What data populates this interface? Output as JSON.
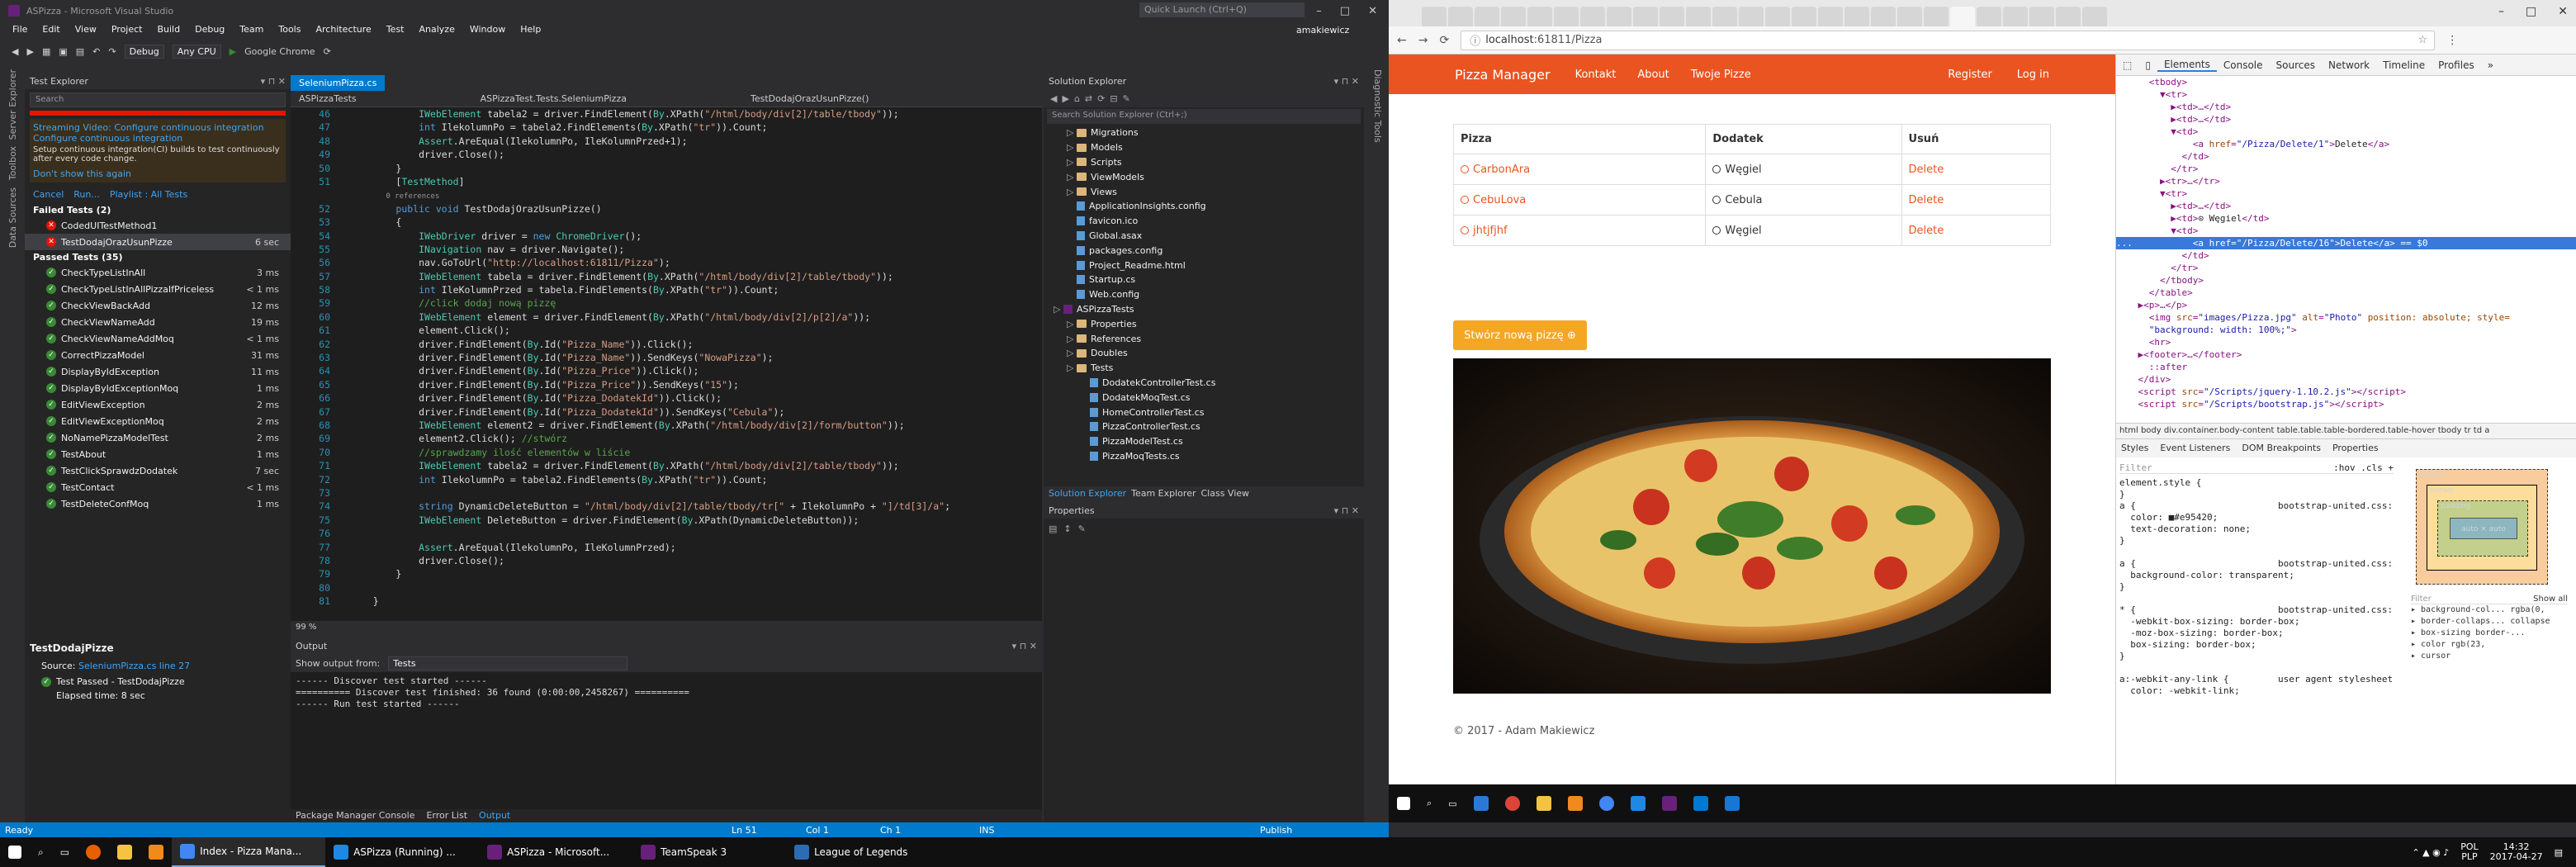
{
  "vs": {
    "title": "ASPizza - Microsoft Visual Studio",
    "quick_launch": "Quick Launch (Ctrl+Q)",
    "user": "amakiewicz",
    "menu": [
      "File",
      "Edit",
      "View",
      "Project",
      "Build",
      "Debug",
      "Team",
      "Tools",
      "Architecture",
      "Test",
      "Analyze",
      "Window",
      "Help"
    ],
    "toolbar": {
      "config": "Debug",
      "platform": "Any CPU",
      "run_target": "Google Chrome"
    },
    "left_sidebar": [
      "Server Explorer",
      "Toolbox",
      "Data Sources"
    ],
    "right_sidebar": [
      "Diagnostic Tools"
    ],
    "test_explorer": {
      "title": "Test Explorer",
      "search_placeholder": "Search",
      "banner_title": "Streaming Video: Configure continuous integration",
      "banner_link": "Configure continuous integration",
      "banner_text": "Setup continuous integration(CI) builds to test continuously after every code change.",
      "dont_show": "Don't show this again",
      "actions": [
        "Cancel",
        "Run...",
        "Playlist : All Tests"
      ],
      "failed_header": "Failed Tests (2)",
      "failed": [
        {
          "name": "CodedUITestMethod1",
          "time": ""
        },
        {
          "name": "TestDodajOrazUsunPizze",
          "time": "6 sec"
        }
      ],
      "passed_header": "Passed Tests (35)",
      "passed": [
        {
          "name": "CheckTypeListInAll",
          "time": "3 ms"
        },
        {
          "name": "CheckTypeListInAllPizzaIfPriceless",
          "time": "< 1 ms"
        },
        {
          "name": "CheckViewBackAdd",
          "time": "12 ms"
        },
        {
          "name": "CheckViewNameAdd",
          "time": "19 ms"
        },
        {
          "name": "CheckViewNameAddMoq",
          "time": "< 1 ms"
        },
        {
          "name": "CorrectPizzaModel",
          "time": "31 ms"
        },
        {
          "name": "DisplayByIdException",
          "time": "11 ms"
        },
        {
          "name": "DisplayByIdExceptionMoq",
          "time": "1 ms"
        },
        {
          "name": "EditViewException",
          "time": "2 ms"
        },
        {
          "name": "EditViewExceptionMoq",
          "time": "2 ms"
        },
        {
          "name": "NoNamePizzaModelTest",
          "time": "2 ms"
        },
        {
          "name": "TestAbout",
          "time": "1 ms"
        },
        {
          "name": "TestClickSprawdzDodatek",
          "time": "7 sec"
        },
        {
          "name": "TestContact",
          "time": "< 1 ms"
        },
        {
          "name": "TestDeleteConfMoq",
          "time": "1 ms"
        }
      ],
      "detail_title": "TestDodajPizze",
      "detail_source_label": "Source:",
      "detail_source": "SeleniumPizza.cs line 27",
      "detail_result": "Test Passed - TestDodajPizze",
      "detail_elapsed": "Elapsed time: 8 sec"
    },
    "editor": {
      "tab": "SeleniumPizza.cs",
      "nav_left": "ASPizzaTests",
      "nav_mid": "ASPizzaTest.Tests.SeleniumPizza",
      "nav_right": "TestDodajOrazUsunPizze()",
      "zoom": "99 %",
      "lines": [
        {
          "n": "46",
          "t": "            IWebElement tabela2 = driver.FindElement(By.XPath(\"/html/body/div[2]/table/tbody\"));"
        },
        {
          "n": "47",
          "t": "            int IlekolumnPo = tabela2.FindElements(By.XPath(\"tr\")).Count;"
        },
        {
          "n": "48",
          "t": "            Assert.AreEqual(IlekolumnPo, IleKolumnPrzed+1);"
        },
        {
          "n": "49",
          "t": "            driver.Close();"
        },
        {
          "n": "50",
          "t": "        }"
        },
        {
          "n": "51",
          "t": "        [TestMethod]"
        },
        {
          "n": "",
          "t": "        0 references"
        },
        {
          "n": "52",
          "t": "        public void TestDodajOrazUsunPizze()"
        },
        {
          "n": "53",
          "t": "        {"
        },
        {
          "n": "54",
          "t": "            IWebDriver driver = new ChromeDriver();"
        },
        {
          "n": "55",
          "t": "            INavigation nav = driver.Navigate();"
        },
        {
          "n": "56",
          "t": "            nav.GoToUrl(\"http://localhost:61811/Pizza\");"
        },
        {
          "n": "57",
          "t": "            IWebElement tabela = driver.FindElement(By.XPath(\"/html/body/div[2]/table/tbody\"));"
        },
        {
          "n": "58",
          "t": "            int IleKolumnPrzed = tabela.FindElements(By.XPath(\"tr\")).Count;"
        },
        {
          "n": "59",
          "t": "            //click dodaj nową pizzę"
        },
        {
          "n": "60",
          "t": "            IWebElement element = driver.FindElement(By.XPath(\"/html/body/div[2]/p[2]/a\"));"
        },
        {
          "n": "61",
          "t": "            element.Click();"
        },
        {
          "n": "62",
          "t": "            driver.FindElement(By.Id(\"Pizza_Name\")).Click();"
        },
        {
          "n": "63",
          "t": "            driver.FindElement(By.Id(\"Pizza_Name\")).SendKeys(\"NowaPizza\");"
        },
        {
          "n": "64",
          "t": "            driver.FindElement(By.Id(\"Pizza_Price\")).Click();"
        },
        {
          "n": "65",
          "t": "            driver.FindElement(By.Id(\"Pizza_Price\")).SendKeys(\"15\");"
        },
        {
          "n": "66",
          "t": "            driver.FindElement(By.Id(\"Pizza_DodatekId\")).Click();"
        },
        {
          "n": "67",
          "t": "            driver.FindElement(By.Id(\"Pizza_DodatekId\")).SendKeys(\"Cebula\");"
        },
        {
          "n": "68",
          "t": "            IWebElement element2 = driver.FindElement(By.XPath(\"/html/body/div[2]/form/button\"));"
        },
        {
          "n": "69",
          "t": "            element2.Click(); //stwórz"
        },
        {
          "n": "70",
          "t": "            //sprawdzamy ilość elementów w liście"
        },
        {
          "n": "71",
          "t": "            IWebElement tabela2 = driver.FindElement(By.XPath(\"/html/body/div[2]/table/tbody\"));"
        },
        {
          "n": "72",
          "t": "            int IlekolumnPo = tabela2.FindElements(By.XPath(\"tr\")).Count;"
        },
        {
          "n": "73",
          "t": ""
        },
        {
          "n": "74",
          "t": "            string DynamicDeleteButton = \"/html/body/div[2]/table/tbody/tr[\" + IlekolumnPo + \"]/td[3]/a\";"
        },
        {
          "n": "75",
          "t": "            IWebElement DeleteButton = driver.FindElement(By.XPath(DynamicDeleteButton));"
        },
        {
          "n": "76",
          "t": ""
        },
        {
          "n": "77",
          "t": "            Assert.AreEqual(IlekolumnPo, IleKolumnPrzed);"
        },
        {
          "n": "78",
          "t": "            driver.Close();"
        },
        {
          "n": "79",
          "t": "        }"
        },
        {
          "n": "80",
          "t": ""
        },
        {
          "n": "81",
          "t": "    }"
        }
      ]
    },
    "output": {
      "title": "Output",
      "show_from_label": "Show output from:",
      "show_from_value": "Tests",
      "lines": [
        "------ Discover test started ------",
        "========== Discover test finished: 36 found (0:00:00,2458267) ==========",
        "------ Run test started ------"
      ],
      "tabs": [
        "Package Manager Console",
        "Error List",
        "Output"
      ]
    },
    "solution_explorer": {
      "title": "Solution Explorer",
      "search_placeholder": "Search Solution Explorer (Ctrl+;)",
      "items": [
        {
          "name": "Migrations",
          "kind": "folder",
          "indent": 1
        },
        {
          "name": "Models",
          "kind": "folder",
          "indent": 1
        },
        {
          "name": "Scripts",
          "kind": "folder",
          "indent": 1
        },
        {
          "name": "ViewModels",
          "kind": "folder",
          "indent": 1
        },
        {
          "name": "Views",
          "kind": "folder",
          "indent": 1
        },
        {
          "name": "ApplicationInsights.config",
          "kind": "file",
          "indent": 1
        },
        {
          "name": "favicon.ico",
          "kind": "file",
          "indent": 1
        },
        {
          "name": "Global.asax",
          "kind": "file",
          "indent": 1
        },
        {
          "name": "packages.config",
          "kind": "file",
          "indent": 1
        },
        {
          "name": "Project_Readme.html",
          "kind": "file",
          "indent": 1
        },
        {
          "name": "Startup.cs",
          "kind": "file",
          "indent": 1
        },
        {
          "name": "Web.config",
          "kind": "file",
          "indent": 1
        },
        {
          "name": "ASPizzaTests",
          "kind": "project",
          "indent": 0
        },
        {
          "name": "Properties",
          "kind": "folder",
          "indent": 1
        },
        {
          "name": "References",
          "kind": "folder",
          "indent": 1
        },
        {
          "name": "Doubles",
          "kind": "folder",
          "indent": 1
        },
        {
          "name": "Tests",
          "kind": "folder",
          "indent": 1
        },
        {
          "name": "DodatekControllerTest.cs",
          "kind": "file",
          "indent": 2
        },
        {
          "name": "DodatekMoqTest.cs",
          "kind": "file",
          "indent": 2
        },
        {
          "name": "HomeControllerTest.cs",
          "kind": "file",
          "indent": 2
        },
        {
          "name": "PizzaControllerTest.cs",
          "kind": "file",
          "indent": 2
        },
        {
          "name": "PizzaModelTest.cs",
          "kind": "file",
          "indent": 2
        },
        {
          "name": "PizzaMoqTests.cs",
          "kind": "file",
          "indent": 2
        }
      ],
      "tabs": [
        "Solution Explorer",
        "Team Explorer",
        "Class View"
      ]
    },
    "properties": {
      "title": "Properties"
    },
    "status": {
      "state": "Ready",
      "ln": "Ln 51",
      "col": "Col 1",
      "ch": "Ch 1",
      "mode": "INS",
      "publish": "Publish"
    }
  },
  "browser": {
    "url_host": "localhost",
    "url_path": ":61811/Pizza",
    "site": {
      "brand": "Pizza Manager",
      "nav": [
        "Kontakt",
        "About",
        "Twoje Pizze"
      ],
      "nav_right": [
        "Register",
        "Log in"
      ],
      "table_headers": [
        "Pizza",
        "Dodatek",
        "Usuń"
      ],
      "rows": [
        {
          "pizza": "CarbonAra",
          "dodatek": "Węgiel",
          "action": "Delete"
        },
        {
          "pizza": "CebuLova",
          "dodatek": "Cebula",
          "action": "Delete"
        },
        {
          "pizza": "jhtjfjhf",
          "dodatek": "Węgiel",
          "action": "Delete"
        }
      ],
      "create_button": "Stwórz nową pizzę ⊕",
      "footer": "© 2017 - Adam Makiewicz"
    },
    "devtools": {
      "tabs": [
        "Elements",
        "Console",
        "Sources",
        "Network",
        "Timeline",
        "Profiles"
      ],
      "breadcrumbs": "html  body  div.container.body-content  table.table.table-bordered.table-hover  tbody  tr  td  a",
      "style_tabs": [
        "Styles",
        "Event Listeners",
        "DOM Breakpoints",
        "Properties"
      ],
      "filter_placeholder": "Filter",
      "filter_hint": ":hov .cls +",
      "show_all": "Show all",
      "box_labels": {
        "margin": "margin",
        "border": "border",
        "padding": "padding",
        "content": "auto × auto"
      },
      "computed": [
        "background-col... rgba(0,",
        "border-collaps... collapse",
        "box-sizing border-...",
        "color rgb(23,",
        "cursor"
      ],
      "computed_filter": "Filter",
      "styles_text": [
        "element.style {",
        "}",
        "a {                          bootstrap-united.css:1103",
        "  color: ■#e95420;",
        "  text-decoration: none;",
        "}",
        "",
        "a {                          bootstrap-united.css:53",
        "  background-color: transparent;",
        "}",
        "",
        "* {                          bootstrap-united.css:1073",
        "  -webkit-box-sizing: border-box;",
        "  -moz-box-sizing: border-box;",
        "  box-sizing: border-box;",
        "}",
        "",
        "a:-webkit-any-link {         user agent stylesheet",
        "  color: -webkit-link;"
      ]
    }
  },
  "taskbar": {
    "items": [
      "Index - Pizza Mana...",
      "ASPizza (Running) ...",
      "ASPizza - Microsoft...",
      "TeamSpeak 3",
      "League of Legends"
    ],
    "lang": "POL",
    "kbd": "PLP",
    "time": "14:32",
    "date": "2017-04-27"
  }
}
